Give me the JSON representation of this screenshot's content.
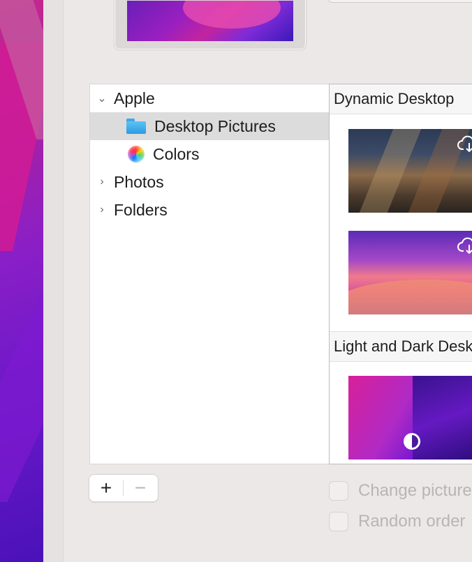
{
  "source_list": {
    "items": [
      {
        "label": "Apple",
        "expanded": true
      },
      {
        "label": "Desktop Pictures",
        "selected": true,
        "icon": "folder-icon"
      },
      {
        "label": "Colors",
        "icon": "color-wheel-icon"
      },
      {
        "label": "Photos",
        "expanded": false
      },
      {
        "label": "Folders",
        "expanded": false
      }
    ]
  },
  "gallery": {
    "sections": [
      {
        "title": "Dynamic Desktop",
        "items": [
          "catalina-wallpaper",
          "monterey-wallpaper"
        ]
      },
      {
        "title": "Light and Dark Desktop",
        "items": [
          "monterey-light-dark-wallpaper"
        ]
      }
    ]
  },
  "controls": {
    "add_label": "+",
    "remove_label": "−"
  },
  "options": {
    "change_picture_label": "Change picture",
    "random_order_label": "Random order"
  }
}
